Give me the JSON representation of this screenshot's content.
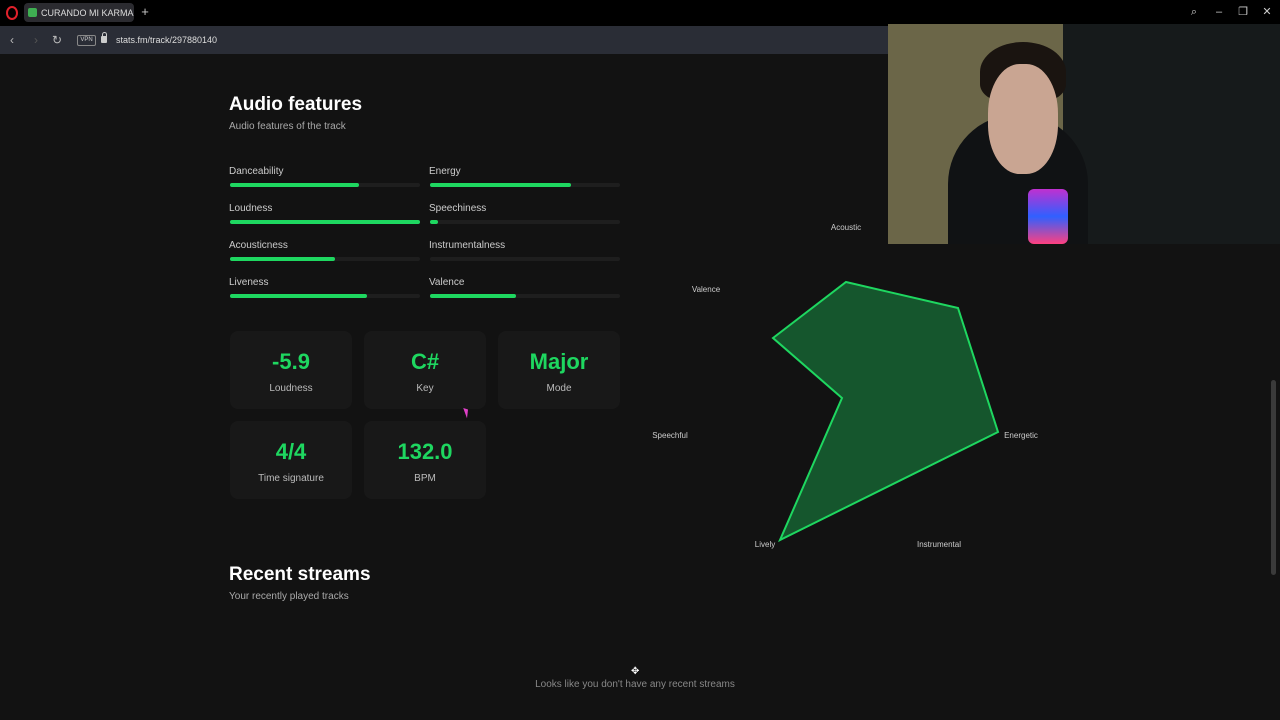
{
  "browser": {
    "tab_title": "CURANDO MI KARMA, a...",
    "new_tab_icon": "plus-icon",
    "url": "stats.fm/track/297880140",
    "vpn_label": "VPN"
  },
  "audio_features": {
    "title": "Audio features",
    "subtitle": "Audio features of the track",
    "features": [
      {
        "label": "Danceability",
        "value": 0.68
      },
      {
        "label": "Energy",
        "value": 0.74
      },
      {
        "label": "Loudness",
        "value": 1.0
      },
      {
        "label": "Speechiness",
        "value": 0.04
      },
      {
        "label": "Acousticness",
        "value": 0.55
      },
      {
        "label": "Instrumentalness",
        "value": 0.0
      },
      {
        "label": "Liveness",
        "value": 0.72
      },
      {
        "label": "Valence",
        "value": 0.45
      }
    ],
    "cards": [
      {
        "value": "-5.9",
        "label": "Loudness"
      },
      {
        "value": "C#",
        "label": "Key"
      },
      {
        "value": "Major",
        "label": "Mode"
      },
      {
        "value": "4/4",
        "label": "Time signature"
      },
      {
        "value": "132.0",
        "label": "BPM"
      }
    ],
    "radar": {
      "labels": [
        "Acoustic",
        "Energetic",
        "Instrumental",
        "Lively",
        "Speechful",
        "Valence"
      ],
      "color": "#1ed760"
    }
  },
  "recent_streams": {
    "title": "Recent streams",
    "subtitle": "Your recently played tracks",
    "empty_message": "Looks like you don't have any recent streams"
  }
}
